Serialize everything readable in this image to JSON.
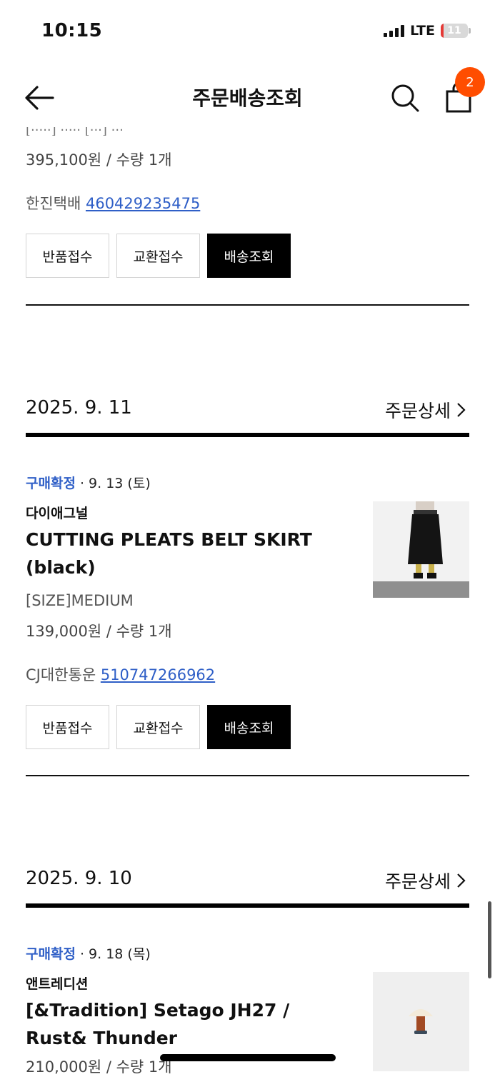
{
  "status_bar": {
    "time": "10:15",
    "network": "LTE",
    "battery": "11",
    "battery_level_percent": 11
  },
  "nav": {
    "title": "주문배송조회",
    "cart_count": "2",
    "icons": [
      "back-arrow-icon",
      "search-icon",
      "shopping-bag-icon"
    ]
  },
  "orders": [
    {
      "price_qty": "395,100원 / 수량 1개",
      "courier": "한진택배",
      "tracking": "460429235475",
      "buttons": {
        "return": "반품접수",
        "exchange": "교환접수",
        "track": "배송조회"
      }
    },
    {
      "date": "2025. 9. 11",
      "detail_label": "주문상세",
      "status": "구매확정",
      "status_date": "· 9. 13 (토)",
      "brand": "다이애그널",
      "name": "CUTTING PLEATS BELT SKIRT (black)",
      "option": "[SIZE]MEDIUM",
      "price_qty": "139,000원 / 수량 1개",
      "courier": "CJ대한통운",
      "tracking": "510747266962",
      "buttons": {
        "return": "반품접수",
        "exchange": "교환접수",
        "track": "배송조회"
      }
    },
    {
      "date": "2025. 9. 10",
      "detail_label": "주문상세",
      "status": "구매확정",
      "status_date": "· 9. 18 (목)",
      "brand": "앤트레디션",
      "name": "[&Tradition] Setago JH27 / Rust& Thunder",
      "price_qty": "210,000원 / 수량 1개"
    }
  ],
  "colors": {
    "accent_blue": "#2f5fc7",
    "badge_orange": "#ff4d00",
    "button_dark": "#000000"
  }
}
